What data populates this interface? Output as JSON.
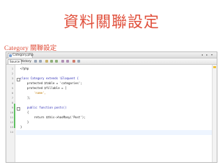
{
  "title": "資料關聯設定",
  "subtitle": "Category 關聯設定",
  "ide": {
    "file_tab": "Category.php",
    "toolbar_tabs": [
      "Source",
      "History"
    ],
    "lines": [
      {
        "num": "1",
        "text": "<?php"
      },
      {
        "num": "2",
        "text": ""
      },
      {
        "num": "3",
        "text": "class Category extends \\Eloquent {"
      },
      {
        "num": "4",
        "text": "    protected $table = 'categories';"
      },
      {
        "num": "5",
        "text": "    protected $fillable = ["
      },
      {
        "num": "6",
        "text": "        'name',"
      },
      {
        "num": "7",
        "text": "    ];"
      },
      {
        "num": "8",
        "text": ""
      },
      {
        "num": "9",
        "text": "    public function posts()"
      },
      {
        "num": "10",
        "text": "    {"
      },
      {
        "num": "11",
        "text": "        return $this->hasMany('Post');"
      },
      {
        "num": "12",
        "text": "    }"
      },
      {
        "num": "13",
        "text": "}"
      },
      {
        "num": "14",
        "text": ""
      }
    ]
  }
}
